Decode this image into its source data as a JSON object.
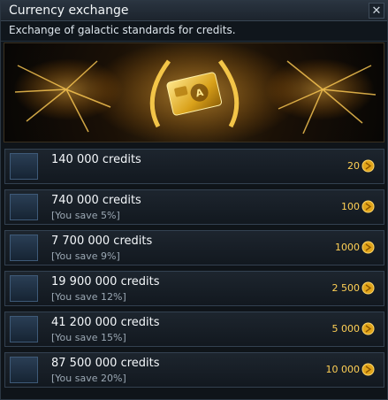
{
  "window": {
    "title": "Currency exchange",
    "close_glyph": "✕",
    "subtitle": "Exchange of galactic standards for credits."
  },
  "offers": [
    {
      "credits": "140 000 credits",
      "saving": "",
      "price": "20",
      "icon": "single-card-pack-icon"
    },
    {
      "credits": "740 000 credits",
      "saving": "[You save 5%]",
      "price": "100",
      "icon": "card-pack-icon"
    },
    {
      "credits": "7 700 000 credits",
      "saving": "[You save 9%]",
      "price": "1000",
      "icon": "card-pack-icon"
    },
    {
      "credits": "19 900 000 credits",
      "saving": "[You save 12%]",
      "price": "2 500",
      "icon": "double-card-pack-icon"
    },
    {
      "credits": "41 200 000 credits",
      "saving": "[You save 15%]",
      "price": "5 000",
      "icon": "triple-card-pack-icon"
    },
    {
      "credits": "87 500 000 credits",
      "saving": "[You save 20%]",
      "price": "10 000",
      "icon": "card-crate-icon"
    }
  ],
  "colors": {
    "accent": "#ffd055",
    "panel": "#1d252e",
    "border": "#334150"
  },
  "icons": {
    "banner": "golden-credit-card-laurel-emblem",
    "currency": "galactic-standard-coin-icon",
    "close": "close-icon"
  }
}
